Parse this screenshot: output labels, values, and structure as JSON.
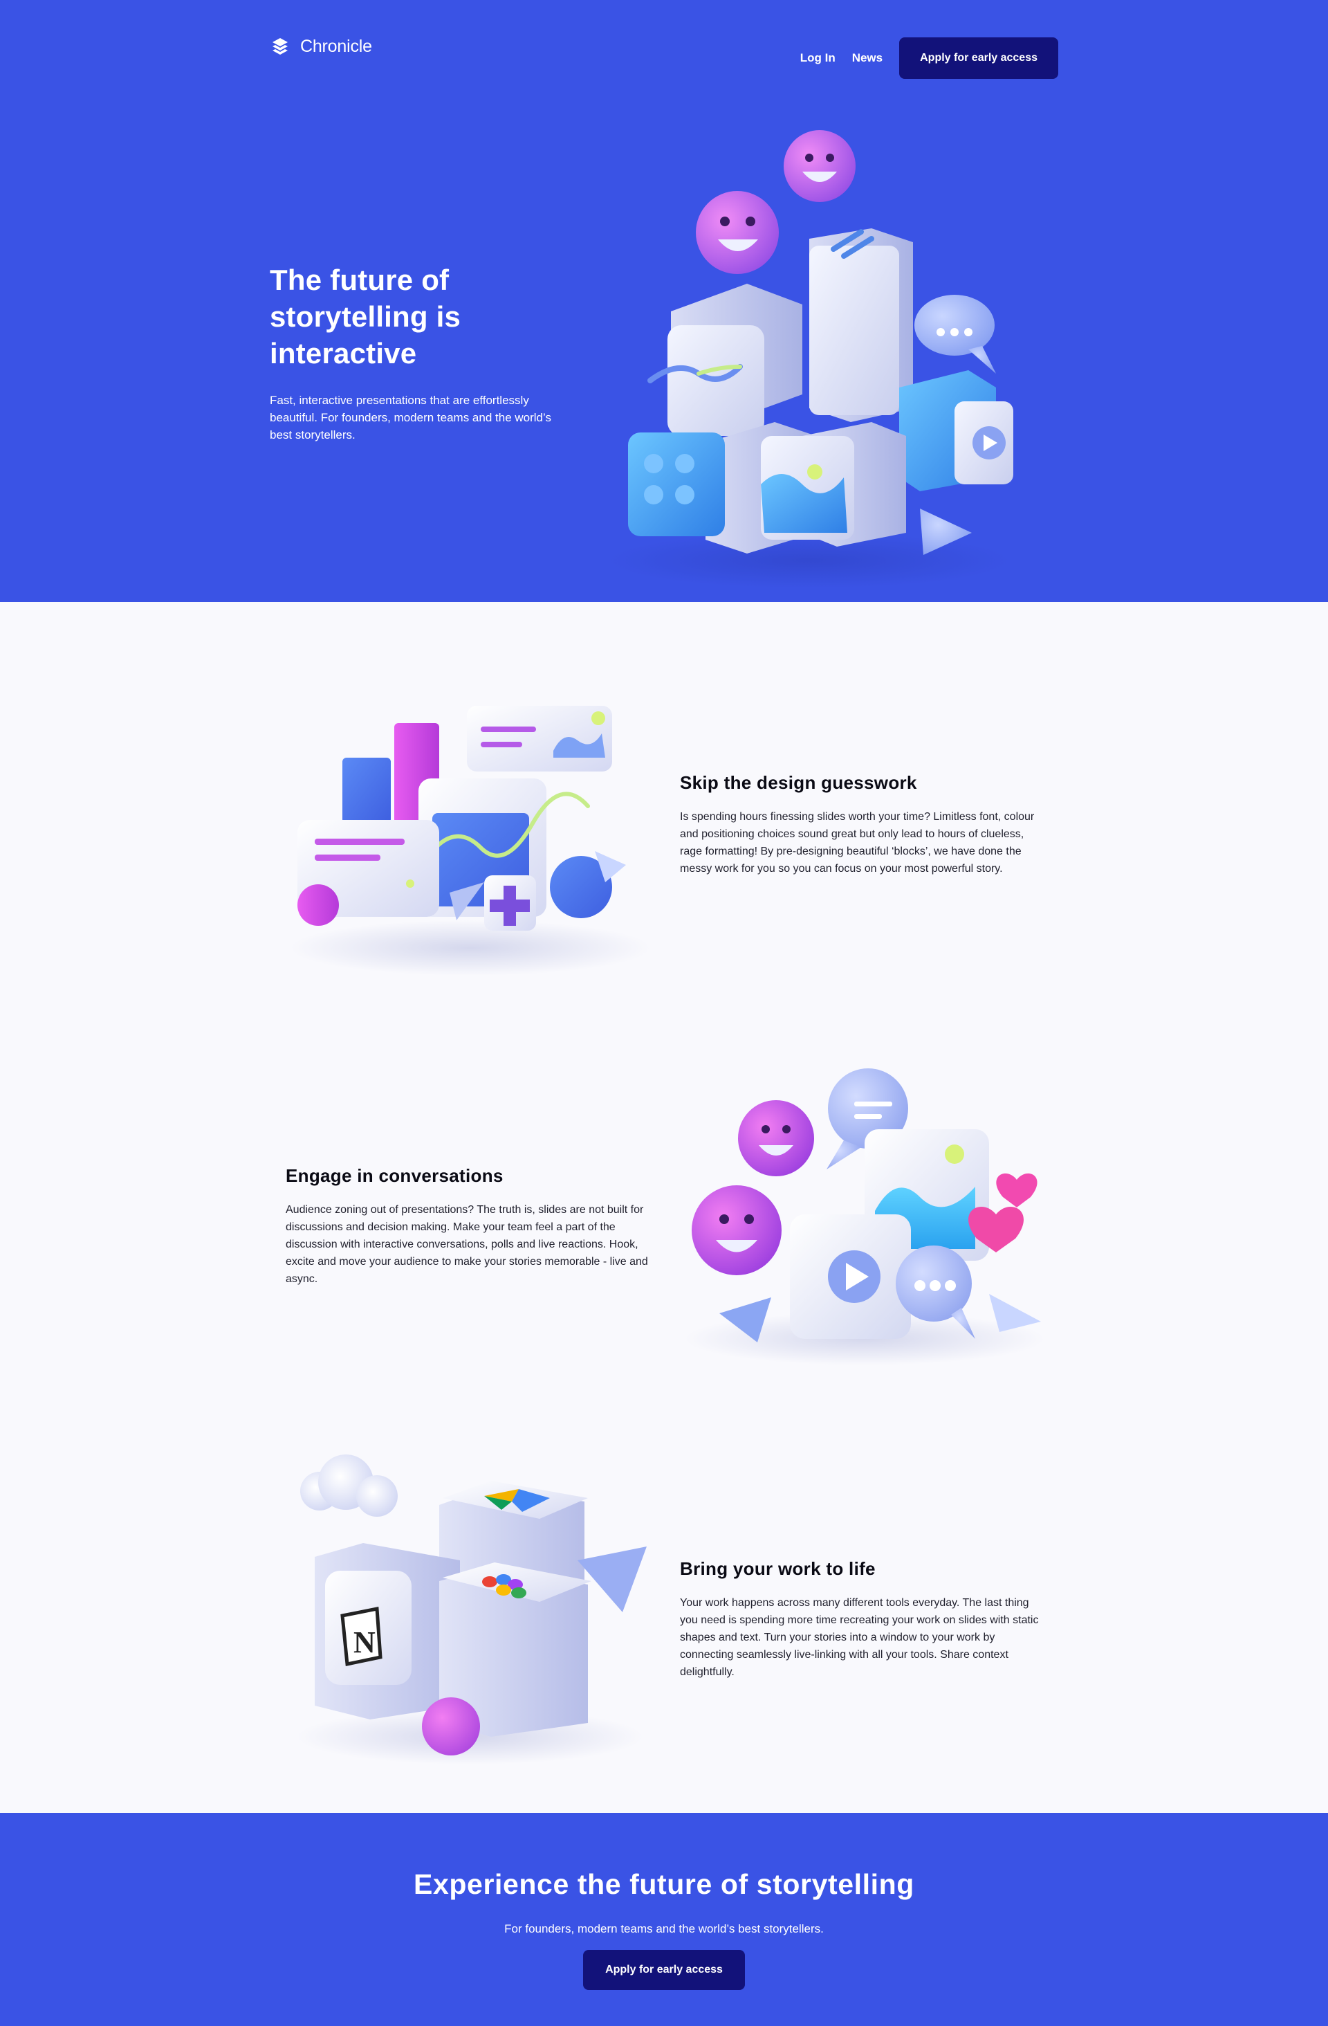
{
  "nav": {
    "brand": "Chronicle",
    "login_label": "Log In",
    "news_label": "News",
    "apply_label": "Apply for early access"
  },
  "hero": {
    "title": "The future of storytelling is interactive",
    "subtitle": "Fast, interactive presentations that are effortlessly beautiful. For founders, modern teams and the world’s best storytellers."
  },
  "features": [
    {
      "title": "Skip the design guesswork",
      "text": "Is spending hours finessing slides worth your time? Limitless font, colour and positioning choices sound great but only lead to hours of clueless, rage formatting! By pre-designing beautiful ‘blocks’, we have done the messy work for you so you can focus on your most powerful story."
    },
    {
      "title": "Engage in conversations",
      "text": "Audience zoning out of presentations? The truth is, slides are not built for discussions and decision making. Make your team feel a part of the discussion with interactive conversations, polls and live reactions. Hook, excite and move your audience to make your stories memorable - live and async."
    },
    {
      "title": "Bring your work to life",
      "text": "Your work happens across many different tools everyday. The last thing you need is spending more time recreating your work on slides with static shapes and text. Turn your stories into a window to your work by connecting seamlessly live-linking with all your tools. Share context delightfully."
    }
  ],
  "cta": {
    "title": "Experience the future of storytelling",
    "subtitle": "For founders, modern teams and the world’s best storytellers.",
    "button_label": "Apply for early access"
  },
  "colors": {
    "brand_blue": "#3a53e5",
    "button_navy": "#12127a",
    "page_bg": "#f9f9fd"
  }
}
